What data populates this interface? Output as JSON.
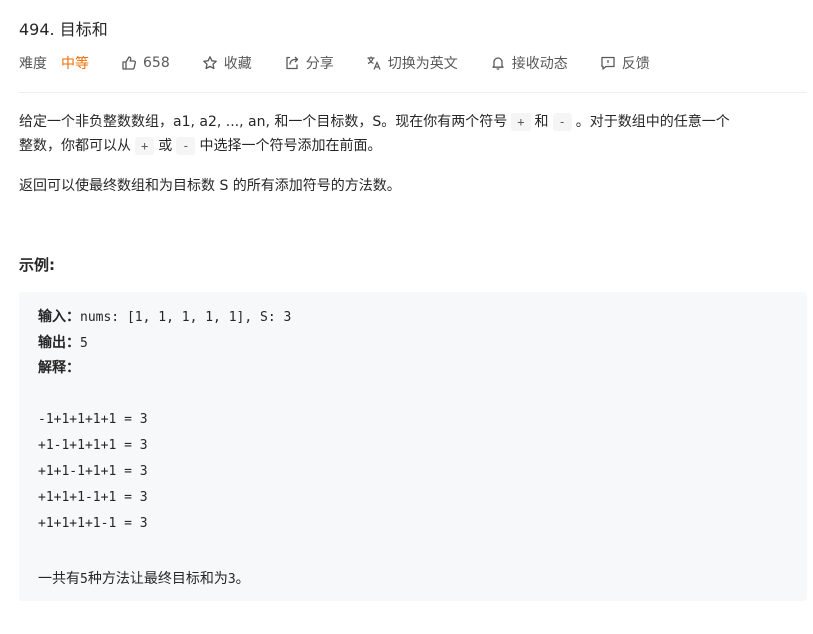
{
  "problem": {
    "title": "494. 目标和"
  },
  "meta": {
    "difficulty_label": "难度",
    "difficulty_value": "中等",
    "likes": "658",
    "favorite": "收藏",
    "share": "分享",
    "switch_lang": "切换为英文",
    "subscribe": "接收动态",
    "feedback": "反馈",
    "icons": [
      "thumbs-up-icon",
      "star-icon",
      "share-icon",
      "translate-icon",
      "bell-icon",
      "feedback-icon"
    ],
    "difficulty_color": "#ef6c00"
  },
  "description": {
    "p1_a": "给定一个非负整数数组，a1, a2, ..., an, 和一个目标数，S。现在你有两个符号",
    "plus": "+",
    "and": "和",
    "minus": "-",
    "p1_b": "。对于数组中的任意一个",
    "p1_c": "整数，你都可以从",
    "or": "或",
    "p1_d": "中选择一个符号添加在前面。",
    "p2": "返回可以使最终数组和为目标数 S 的所有添加符号的方法数。"
  },
  "example": {
    "heading": "示例:",
    "input_label": "输入：",
    "input_value": "nums: [1, 1, 1, 1, 1], S: 3",
    "output_label": "输出：",
    "output_value": "5",
    "explain_label": "解释：",
    "lines": [
      "-1+1+1+1+1 = 3",
      "+1-1+1+1+1 = 3",
      "+1+1-1+1+1 = 3",
      "+1+1+1-1+1 = 3",
      "+1+1+1+1-1 = 3"
    ],
    "summary_a": "一共有",
    "summary_n": "5",
    "summary_b": "种方法让最终目标和为",
    "summary_s": "3",
    "summary_c": "。"
  }
}
